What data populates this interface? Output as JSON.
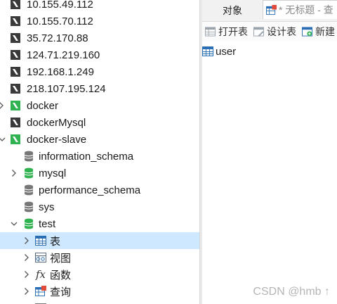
{
  "tree": {
    "connections": [
      {
        "label": "10.155.49.112"
      },
      {
        "label": "10.155.70.112"
      },
      {
        "label": "35.72.170.88"
      },
      {
        "label": "124.71.219.160"
      },
      {
        "label": "192.168.1.249"
      },
      {
        "label": "218.107.195.124"
      }
    ],
    "docker": {
      "label": "docker"
    },
    "dockerMysql": {
      "label": "dockerMysql"
    },
    "dockerSlave": {
      "label": "docker-slave"
    },
    "databases": [
      {
        "label": "information_schema"
      },
      {
        "label": "mysql"
      },
      {
        "label": "performance_schema"
      },
      {
        "label": "sys"
      },
      {
        "label": "test"
      }
    ],
    "test_children": [
      {
        "label": "表",
        "icon": "table-icon"
      },
      {
        "label": "视图",
        "icon": "view-icon"
      },
      {
        "label": "函数",
        "icon": "function-icon"
      },
      {
        "label": "查询",
        "icon": "query-icon"
      }
    ]
  },
  "right": {
    "tab_objects": "对象",
    "tab_query": "* 无标题 - 查",
    "toolbar": {
      "open_table": "打开表",
      "design_table": "设计表",
      "new_table": "新建"
    },
    "object_item": "user"
  },
  "watermark": "CSDN @hmb ↑",
  "colors": {
    "connection_green": "#2fb24f",
    "connection_grey": "#3a3a3a",
    "selected_row": "#cde8ff",
    "table_icon_blue": "#2a6fb5"
  }
}
